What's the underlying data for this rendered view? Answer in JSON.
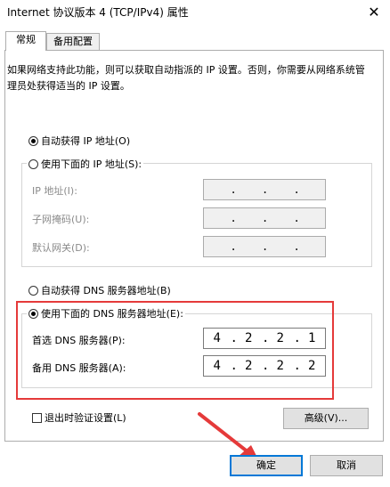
{
  "window": {
    "title": "Internet 协议版本 4 (TCP/IPv4) 属性",
    "close_glyph": "✕"
  },
  "tabs": [
    {
      "label": "常规"
    },
    {
      "label": "备用配置"
    }
  ],
  "description": "如果网络支持此功能，则可以获取自动指派的 IP 设置。否则，你需要从网络系统管理员处获得适当的 IP 设置。",
  "ip": {
    "auto_label": "自动获得 IP 地址(O)",
    "manual_label": "使用下面的 IP 地址(S):",
    "auto_selected": true,
    "fields": [
      {
        "label": "IP 地址(I):",
        "value": [
          "",
          "",
          "",
          ""
        ]
      },
      {
        "label": "子网掩码(U):",
        "value": [
          "",
          "",
          "",
          ""
        ]
      },
      {
        "label": "默认网关(D):",
        "value": [
          "",
          "",
          "",
          ""
        ]
      }
    ]
  },
  "dns": {
    "auto_label": "自动获得 DNS 服务器地址(B)",
    "manual_label": "使用下面的 DNS 服务器地址(E):",
    "manual_selected": true,
    "fields": [
      {
        "label": "首选 DNS 服务器(P):",
        "value": [
          "4",
          "2",
          "2",
          "1"
        ]
      },
      {
        "label": "备用 DNS 服务器(A):",
        "value": [
          "4",
          "2",
          "2",
          "2"
        ]
      }
    ]
  },
  "validate_label": "退出时验证设置(L)",
  "advanced_label": "高级(V)...",
  "ok_label": "确定",
  "cancel_label": "取消",
  "colors": {
    "annotation_red": "#e53a3a",
    "focus_blue": "#0078d7"
  }
}
